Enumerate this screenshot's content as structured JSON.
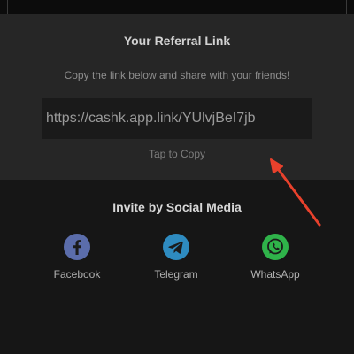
{
  "referral": {
    "title": "Your Referral Link",
    "subtitle": "Copy the link below and share with your friends!",
    "link": "https://cashk.app.link/YUlvjBeI7jb",
    "copy_action": "Tap to Copy"
  },
  "social": {
    "title": "Invite by Social Media",
    "items": [
      {
        "label": "Facebook",
        "icon": "facebook-icon",
        "color": "#5b6dab"
      },
      {
        "label": "Telegram",
        "icon": "telegram-icon",
        "color": "#2e8bc0"
      },
      {
        "label": "WhatsApp",
        "icon": "whatsapp-icon",
        "color": "#2fb34a"
      }
    ]
  },
  "annotation": {
    "color": "#e8412c"
  }
}
